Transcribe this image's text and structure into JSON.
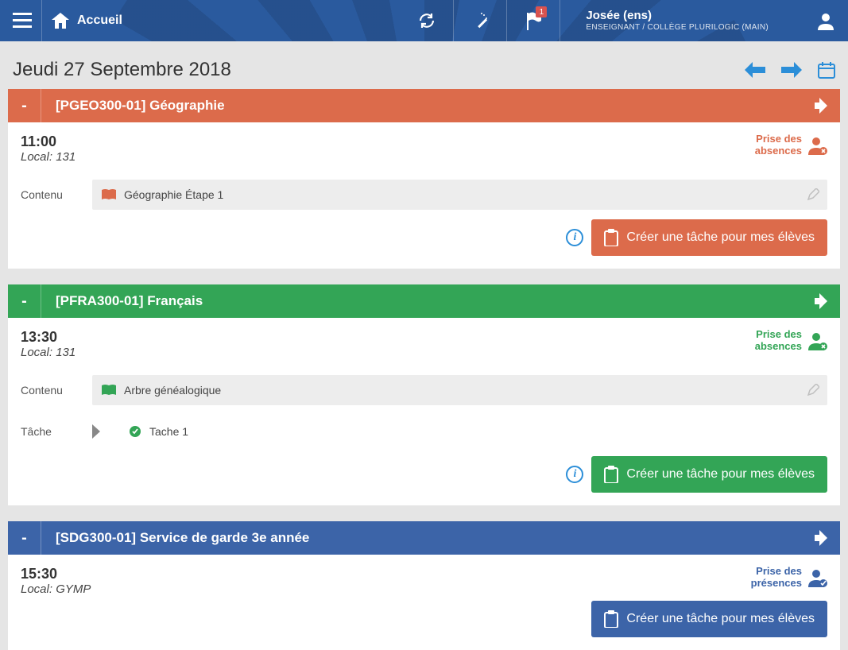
{
  "header": {
    "home_label": "Accueil",
    "flag_badge": "1",
    "user_name": "Josée (ens)",
    "user_role": "ENSEIGNANT / COLLÈGE PLURILOGIC (MAIN)"
  },
  "page": {
    "date_title": "Jeudi 27 Septembre 2018"
  },
  "classes": [
    {
      "collapse": "-",
      "title": "[PGEO300-01] Géographie",
      "time": "11:00",
      "room": "Local: 131",
      "absence_label": "Prise des\nabsences",
      "content_label": "Contenu",
      "content_value": "Géographie Étape 1",
      "create_label": "Créer une tâche pour mes élèves"
    },
    {
      "collapse": "-",
      "title": "[PFRA300-01] Français",
      "time": "13:30",
      "room": "Local: 131",
      "absence_label": "Prise des\nabsences",
      "content_label": "Contenu",
      "content_value": "Arbre généalogique",
      "task_label": "Tâche",
      "task_value": "Tache 1",
      "create_label": "Créer une tâche pour mes élèves"
    },
    {
      "collapse": "-",
      "title": "[SDG300-01] Service de garde 3e année",
      "time": "15:30",
      "room": "Local: GYMP",
      "absence_label": "Prise des\nprésences",
      "create_label": "Créer une tâche pour mes élèves"
    }
  ]
}
